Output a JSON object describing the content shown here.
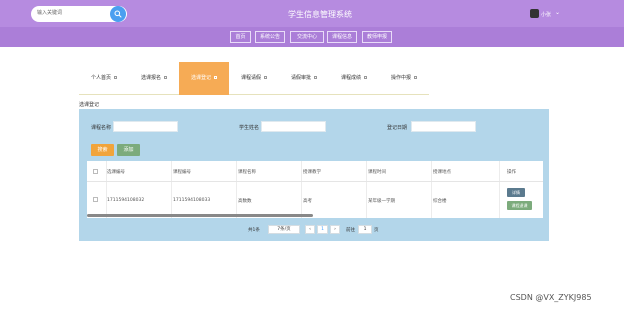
{
  "header": {
    "search_placeholder": "输入关键词",
    "title": "学生信息管理系统",
    "user_name": "小张",
    "caret": "⌄",
    "search_icon": "search-icon"
  },
  "nav": [
    "首页",
    "系统公告",
    "交流中心",
    "课程信息",
    "教师申报"
  ],
  "tabs": [
    "个人首页",
    "选课报名",
    "选课登记",
    "课程请假",
    "请假审批",
    "课程成绩",
    "操作中报"
  ],
  "section_title": "选课登记",
  "filters": {
    "course_name_label": "课程名称",
    "student_name_label": "学生姓名",
    "login_time_label": "登记日期"
  },
  "buttons": {
    "search": "搜索",
    "add": "添加"
  },
  "table": {
    "headers": [
      "选课编号",
      "课程编号",
      "课程名称",
      "授课教学",
      "课程时间",
      "授课地点",
      "操作"
    ],
    "rows": [
      [
        "1711594108032",
        "1711594108033",
        "高数数",
        "高考",
        "某年级一学期",
        "综合楼"
      ]
    ],
    "row_actions": {
      "edit": "详情",
      "delete": "课程退课"
    }
  },
  "pagination": {
    "total": "共1条",
    "page_size": "7条/页",
    "prev": "‹",
    "page": "1",
    "next": "›",
    "goto_label": "前往",
    "goto_value": "1",
    "page_suffix": "页"
  },
  "watermark": "CSDN @VX_ZYKJ985",
  "colors": {
    "header": "#b68be0",
    "nav": "#ab7ed8",
    "active_tab": "#f6ab55",
    "panel": "#b3d6ea"
  }
}
